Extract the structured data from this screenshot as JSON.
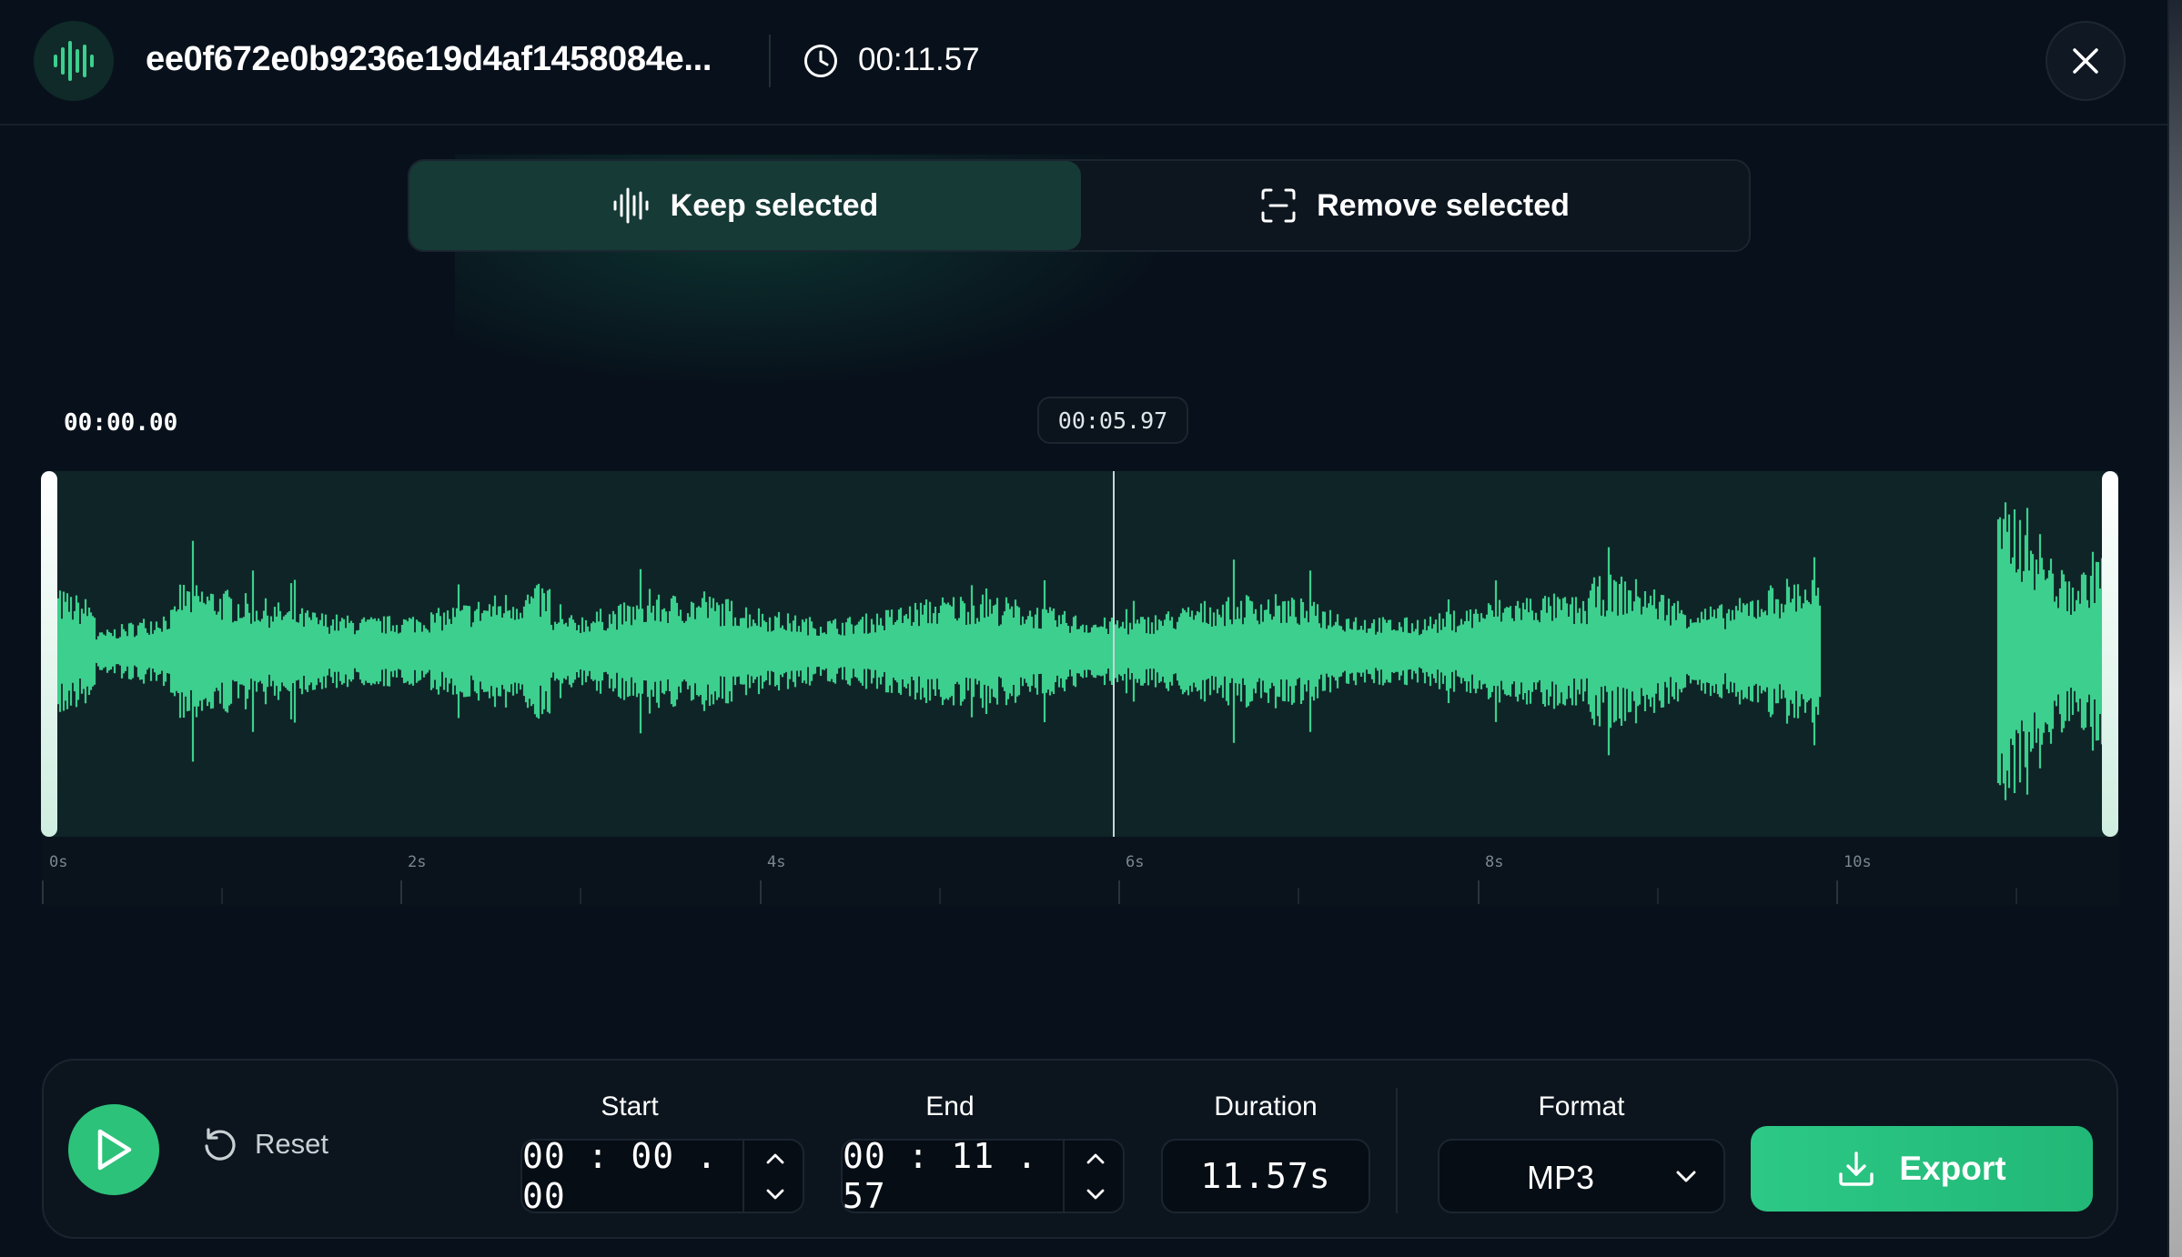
{
  "header": {
    "filename": "ee0f672e0b9236e19d4af1458084e...",
    "duration": "00:11.57"
  },
  "mode_toggle": {
    "keep_label": "Keep selected",
    "remove_label": "Remove selected",
    "active": "keep"
  },
  "timeline": {
    "selection_start_label": "00:00.00",
    "playhead_label": "00:05.97",
    "playhead_seconds": 5.97,
    "total_seconds": 11.57,
    "ticks": [
      "0s",
      "2s",
      "4s",
      "6s",
      "8s",
      "10s"
    ]
  },
  "controls": {
    "reset_label": "Reset",
    "start_label": "Start",
    "start_value": "00 : 00 . 00",
    "end_label": "End",
    "end_value": "00 : 11 . 57",
    "duration_label": "Duration",
    "duration_value": "11.57s",
    "format_label": "Format",
    "format_value": "MP3",
    "export_label": "Export"
  },
  "colors": {
    "accent": "#2cc27a",
    "waveform": "#3ccf8e",
    "background": "#08111b"
  }
}
